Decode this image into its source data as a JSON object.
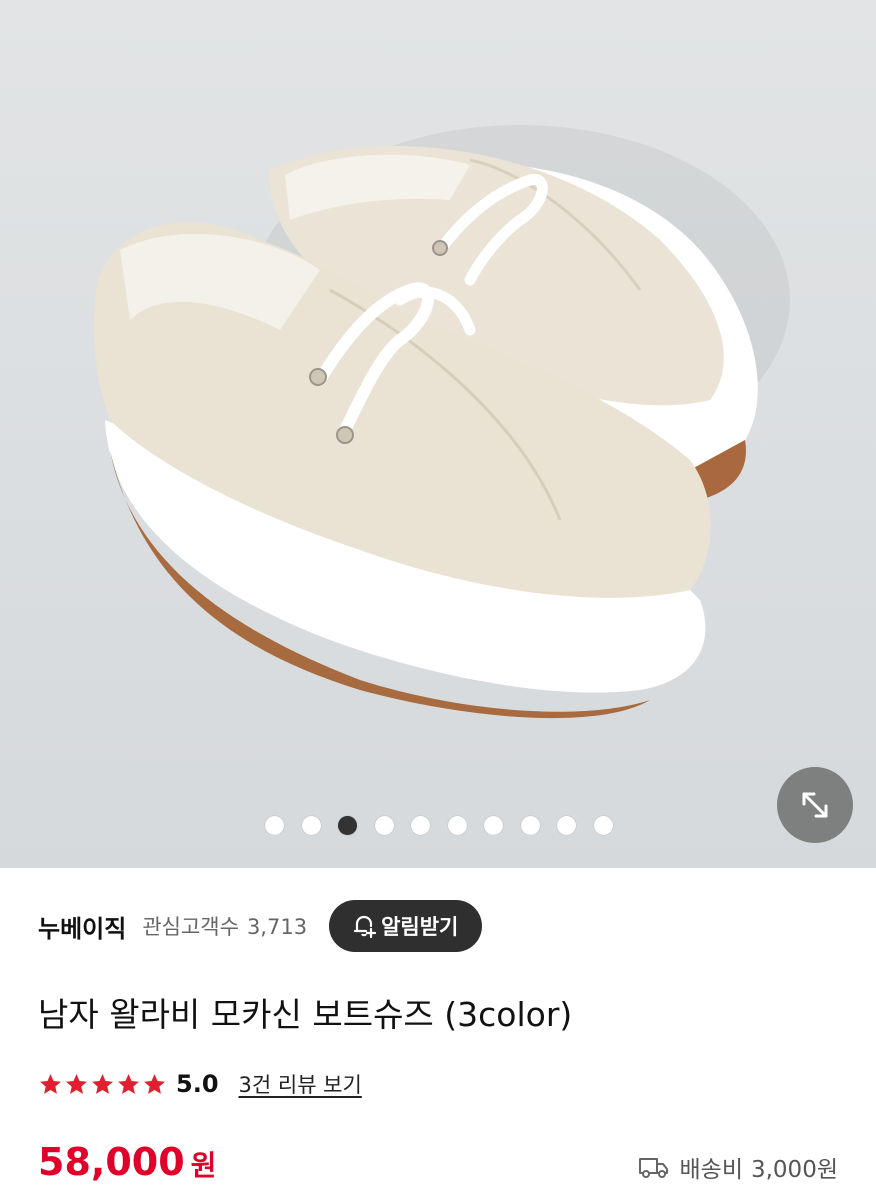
{
  "product_image": {
    "alt": "",
    "carousel_total": 10,
    "carousel_active_index": 2
  },
  "icons": {
    "expand": "expand-arrows-icon",
    "bell": "bell-plus-icon",
    "star": "star-icon",
    "truck": "delivery-truck-icon"
  },
  "colors": {
    "price": "#e0002a",
    "stars": "#e0202e",
    "alarm_button_bg": "#2f2f2f"
  },
  "seller": {
    "name": "누베이직",
    "fans_label": "관심고객수",
    "fans_count": "3,713",
    "alarm_button_label": "알림받기"
  },
  "product": {
    "title": "남자 왈라비 모카신 보트슈즈 (3color)"
  },
  "rating": {
    "stars": 5,
    "score": "5.0",
    "review_link": "3건 리뷰 보기"
  },
  "price": {
    "amount": "58,000",
    "unit": "원"
  },
  "shipping": {
    "label": "배송비",
    "value": "3,000원"
  }
}
